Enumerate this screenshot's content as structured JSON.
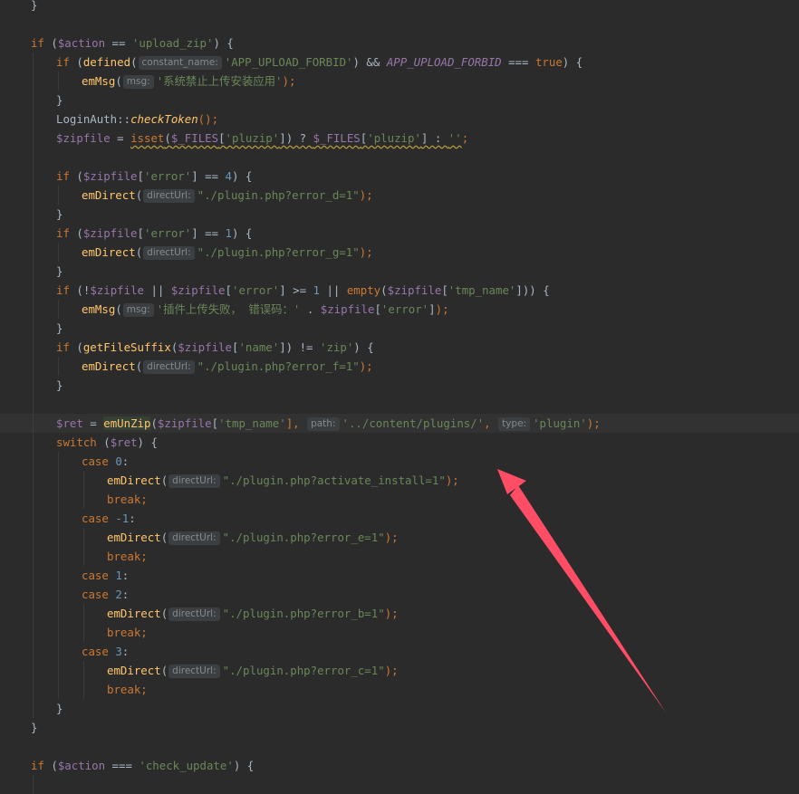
{
  "colors": {
    "background": "#2b2b2b",
    "current_line": "#323232",
    "keyword": "#cc7832",
    "variable": "#9876aa",
    "string": "#6a8759",
    "number": "#6897bb",
    "function": "#ffc66d",
    "plain": "#a9b7c6",
    "hint_background": "#3b3f41",
    "hint_text": "#868a8c",
    "annotation_arrow": "#ff4d66"
  },
  "annotation": {
    "icon": "red-arrow-icon"
  },
  "code_lines": [
    {
      "indent": 0,
      "tokens": [
        {
          "t": "}",
          "c": "pln"
        }
      ]
    },
    {
      "indent": 0,
      "tokens": []
    },
    {
      "indent": 0,
      "tokens": [
        {
          "t": "if",
          "c": "kw"
        },
        {
          "t": " (",
          "c": "pln"
        },
        {
          "t": "$action",
          "c": "var"
        },
        {
          "t": " == ",
          "c": "pln"
        },
        {
          "t": "'upload_zip'",
          "c": "str"
        },
        {
          "t": ") {",
          "c": "pln"
        }
      ]
    },
    {
      "indent": 1,
      "tokens": [
        {
          "t": "if",
          "c": "kw"
        },
        {
          "t": " (",
          "c": "pln"
        },
        {
          "t": "defined",
          "c": "fn"
        },
        {
          "t": "(",
          "c": "pln"
        },
        {
          "t": "constant_name:",
          "c": "hint"
        },
        {
          "t": "'APP_UPLOAD_FORBID'",
          "c": "str"
        },
        {
          "t": ") && ",
          "c": "pln"
        },
        {
          "t": "APP_UPLOAD_FORBID",
          "c": "cst"
        },
        {
          "t": " === ",
          "c": "pln"
        },
        {
          "t": "true",
          "c": "kw"
        },
        {
          "t": ") {",
          "c": "pln"
        }
      ]
    },
    {
      "indent": 2,
      "tokens": [
        {
          "t": "emMsg",
          "c": "fn"
        },
        {
          "t": "(",
          "c": "pln"
        },
        {
          "t": "msg:",
          "c": "hint"
        },
        {
          "t": "'系统禁止上传安装应用'",
          "c": "str"
        },
        {
          "t": ");",
          "c": "kw"
        }
      ]
    },
    {
      "indent": 1,
      "tokens": [
        {
          "t": "}",
          "c": "pln"
        }
      ]
    },
    {
      "indent": 1,
      "tokens": [
        {
          "t": "LoginAuth::",
          "c": "pln"
        },
        {
          "t": "checkToken",
          "c": "sfn"
        },
        {
          "t": "();",
          "c": "kw"
        }
      ]
    },
    {
      "indent": 1,
      "tokens": [
        {
          "t": "$zipfile",
          "c": "var"
        },
        {
          "t": " = ",
          "c": "pln"
        },
        {
          "t": "isset",
          "c": "kw",
          "w": true
        },
        {
          "t": "(",
          "c": "pln",
          "w": true
        },
        {
          "t": "$_FILES",
          "c": "var",
          "w": true
        },
        {
          "t": "[",
          "c": "pln",
          "w": true
        },
        {
          "t": "'pluzip'",
          "c": "str",
          "w": true
        },
        {
          "t": "]) ? ",
          "c": "pln",
          "w": true
        },
        {
          "t": "$_FILES",
          "c": "var",
          "w": true
        },
        {
          "t": "[",
          "c": "pln",
          "w": true
        },
        {
          "t": "'pluzip'",
          "c": "str",
          "w": true
        },
        {
          "t": "] : ",
          "c": "pln",
          "w": true
        },
        {
          "t": "''",
          "c": "str",
          "w": true
        },
        {
          "t": ";",
          "c": "kw"
        }
      ]
    },
    {
      "indent": 1,
      "tokens": []
    },
    {
      "indent": 1,
      "tokens": [
        {
          "t": "if",
          "c": "kw"
        },
        {
          "t": " (",
          "c": "pln"
        },
        {
          "t": "$zipfile",
          "c": "var"
        },
        {
          "t": "[",
          "c": "pln"
        },
        {
          "t": "'error'",
          "c": "str"
        },
        {
          "t": "] == ",
          "c": "pln"
        },
        {
          "t": "4",
          "c": "num"
        },
        {
          "t": ") {",
          "c": "pln"
        }
      ]
    },
    {
      "indent": 2,
      "tokens": [
        {
          "t": "emDirect",
          "c": "fn"
        },
        {
          "t": "(",
          "c": "pln"
        },
        {
          "t": "directUrl:",
          "c": "hint"
        },
        {
          "t": "\"./plugin.php?error_d=1\"",
          "c": "str"
        },
        {
          "t": ");",
          "c": "kw"
        }
      ]
    },
    {
      "indent": 1,
      "tokens": [
        {
          "t": "}",
          "c": "pln"
        }
      ]
    },
    {
      "indent": 1,
      "tokens": [
        {
          "t": "if",
          "c": "kw"
        },
        {
          "t": " (",
          "c": "pln"
        },
        {
          "t": "$zipfile",
          "c": "var"
        },
        {
          "t": "[",
          "c": "pln"
        },
        {
          "t": "'error'",
          "c": "str"
        },
        {
          "t": "] == ",
          "c": "pln"
        },
        {
          "t": "1",
          "c": "num"
        },
        {
          "t": ") {",
          "c": "pln"
        }
      ]
    },
    {
      "indent": 2,
      "tokens": [
        {
          "t": "emDirect",
          "c": "fn"
        },
        {
          "t": "(",
          "c": "pln"
        },
        {
          "t": "directUrl:",
          "c": "hint"
        },
        {
          "t": "\"./plugin.php?error_g=1\"",
          "c": "str"
        },
        {
          "t": ");",
          "c": "kw"
        }
      ]
    },
    {
      "indent": 1,
      "tokens": [
        {
          "t": "}",
          "c": "pln"
        }
      ]
    },
    {
      "indent": 1,
      "tokens": [
        {
          "t": "if",
          "c": "kw"
        },
        {
          "t": " (!",
          "c": "pln"
        },
        {
          "t": "$zipfile",
          "c": "var"
        },
        {
          "t": " || ",
          "c": "pln"
        },
        {
          "t": "$zipfile",
          "c": "var"
        },
        {
          "t": "[",
          "c": "pln"
        },
        {
          "t": "'error'",
          "c": "str"
        },
        {
          "t": "] >= ",
          "c": "pln"
        },
        {
          "t": "1",
          "c": "num"
        },
        {
          "t": " || ",
          "c": "pln"
        },
        {
          "t": "empty",
          "c": "kw"
        },
        {
          "t": "(",
          "c": "pln"
        },
        {
          "t": "$zipfile",
          "c": "var"
        },
        {
          "t": "[",
          "c": "pln"
        },
        {
          "t": "'tmp_name'",
          "c": "str"
        },
        {
          "t": "])) {",
          "c": "pln"
        }
      ]
    },
    {
      "indent": 2,
      "tokens": [
        {
          "t": "emMsg",
          "c": "fn"
        },
        {
          "t": "(",
          "c": "pln"
        },
        {
          "t": "msg:",
          "c": "hint"
        },
        {
          "t": "'插件上传失败， 错误码：'",
          "c": "str"
        },
        {
          "t": " . ",
          "c": "pln"
        },
        {
          "t": "$zipfile",
          "c": "var"
        },
        {
          "t": "[",
          "c": "pln"
        },
        {
          "t": "'error'",
          "c": "str"
        },
        {
          "t": "]",
          "c": "pln"
        },
        {
          "t": ");",
          "c": "kw"
        }
      ]
    },
    {
      "indent": 1,
      "tokens": [
        {
          "t": "}",
          "c": "pln"
        }
      ]
    },
    {
      "indent": 1,
      "tokens": [
        {
          "t": "if",
          "c": "kw"
        },
        {
          "t": " (",
          "c": "pln"
        },
        {
          "t": "getFileSuffix",
          "c": "fn"
        },
        {
          "t": "(",
          "c": "pln"
        },
        {
          "t": "$zipfile",
          "c": "var"
        },
        {
          "t": "[",
          "c": "pln"
        },
        {
          "t": "'name'",
          "c": "str"
        },
        {
          "t": "]) != ",
          "c": "pln"
        },
        {
          "t": "'zip'",
          "c": "str"
        },
        {
          "t": ") {",
          "c": "pln"
        }
      ]
    },
    {
      "indent": 2,
      "tokens": [
        {
          "t": "emDirect",
          "c": "fn"
        },
        {
          "t": "(",
          "c": "pln"
        },
        {
          "t": "directUrl:",
          "c": "hint"
        },
        {
          "t": "\"./plugin.php?error_f=1\"",
          "c": "str"
        },
        {
          "t": ");",
          "c": "kw"
        }
      ]
    },
    {
      "indent": 1,
      "tokens": [
        {
          "t": "}",
          "c": "pln"
        }
      ]
    },
    {
      "indent": 1,
      "tokens": []
    },
    {
      "indent": 1,
      "current": true,
      "tokens": [
        {
          "t": "$ret",
          "c": "var"
        },
        {
          "t": " = ",
          "c": "pln"
        },
        {
          "t": "emUnZip",
          "c": "hl"
        },
        {
          "t": "(",
          "c": "pln"
        },
        {
          "t": "$zipfile",
          "c": "var"
        },
        {
          "t": "[",
          "c": "pln"
        },
        {
          "t": "'tmp_name'",
          "c": "str"
        },
        {
          "t": "], ",
          "c": "kw"
        },
        {
          "t": "path:",
          "c": "hint"
        },
        {
          "t": "'../content/plugins/'",
          "c": "str"
        },
        {
          "t": ", ",
          "c": "kw"
        },
        {
          "t": "type:",
          "c": "hint"
        },
        {
          "t": "'plugin'",
          "c": "str"
        },
        {
          "t": ");",
          "c": "kw"
        }
      ]
    },
    {
      "indent": 1,
      "tokens": [
        {
          "t": "switch",
          "c": "kw"
        },
        {
          "t": " (",
          "c": "pln"
        },
        {
          "t": "$ret",
          "c": "var"
        },
        {
          "t": ") {",
          "c": "pln"
        }
      ]
    },
    {
      "indent": 2,
      "tokens": [
        {
          "t": "case",
          "c": "kw"
        },
        {
          "t": " ",
          "c": "pln"
        },
        {
          "t": "0",
          "c": "num"
        },
        {
          "t": ":",
          "c": "pln"
        }
      ]
    },
    {
      "indent": 3,
      "tokens": [
        {
          "t": "emDirect",
          "c": "fn"
        },
        {
          "t": "(",
          "c": "pln"
        },
        {
          "t": "directUrl:",
          "c": "hint"
        },
        {
          "t": "\"./plugin.php?activate_install=1\"",
          "c": "str"
        },
        {
          "t": ");",
          "c": "kw"
        }
      ]
    },
    {
      "indent": 3,
      "tokens": [
        {
          "t": "break;",
          "c": "kw"
        }
      ]
    },
    {
      "indent": 2,
      "tokens": [
        {
          "t": "case",
          "c": "kw"
        },
        {
          "t": " ",
          "c": "pln"
        },
        {
          "t": "-1",
          "c": "num"
        },
        {
          "t": ":",
          "c": "pln"
        }
      ]
    },
    {
      "indent": 3,
      "tokens": [
        {
          "t": "emDirect",
          "c": "fn"
        },
        {
          "t": "(",
          "c": "pln"
        },
        {
          "t": "directUrl:",
          "c": "hint"
        },
        {
          "t": "\"./plugin.php?error_e=1\"",
          "c": "str"
        },
        {
          "t": ");",
          "c": "kw"
        }
      ]
    },
    {
      "indent": 3,
      "tokens": [
        {
          "t": "break;",
          "c": "kw"
        }
      ]
    },
    {
      "indent": 2,
      "tokens": [
        {
          "t": "case",
          "c": "kw"
        },
        {
          "t": " ",
          "c": "pln"
        },
        {
          "t": "1",
          "c": "num"
        },
        {
          "t": ":",
          "c": "pln"
        }
      ]
    },
    {
      "indent": 2,
      "tokens": [
        {
          "t": "case",
          "c": "kw"
        },
        {
          "t": " ",
          "c": "pln"
        },
        {
          "t": "2",
          "c": "num"
        },
        {
          "t": ":",
          "c": "pln"
        }
      ]
    },
    {
      "indent": 3,
      "tokens": [
        {
          "t": "emDirect",
          "c": "fn"
        },
        {
          "t": "(",
          "c": "pln"
        },
        {
          "t": "directUrl:",
          "c": "hint"
        },
        {
          "t": "\"./plugin.php?error_b=1\"",
          "c": "str"
        },
        {
          "t": ");",
          "c": "kw"
        }
      ]
    },
    {
      "indent": 3,
      "tokens": [
        {
          "t": "break;",
          "c": "kw"
        }
      ]
    },
    {
      "indent": 2,
      "tokens": [
        {
          "t": "case",
          "c": "kw"
        },
        {
          "t": " ",
          "c": "pln"
        },
        {
          "t": "3",
          "c": "num"
        },
        {
          "t": ":",
          "c": "pln"
        }
      ]
    },
    {
      "indent": 3,
      "tokens": [
        {
          "t": "emDirect",
          "c": "fn"
        },
        {
          "t": "(",
          "c": "pln"
        },
        {
          "t": "directUrl:",
          "c": "hint"
        },
        {
          "t": "\"./plugin.php?error_c=1\"",
          "c": "str"
        },
        {
          "t": ");",
          "c": "kw"
        }
      ]
    },
    {
      "indent": 3,
      "tokens": [
        {
          "t": "break;",
          "c": "kw"
        }
      ]
    },
    {
      "indent": 1,
      "tokens": [
        {
          "t": "}",
          "c": "pln"
        }
      ]
    },
    {
      "indent": 0,
      "tokens": [
        {
          "t": "}",
          "c": "pln"
        }
      ]
    },
    {
      "indent": 0,
      "tokens": []
    },
    {
      "indent": 0,
      "tokens": [
        {
          "t": "if",
          "c": "kw"
        },
        {
          "t": " (",
          "c": "pln"
        },
        {
          "t": "$action",
          "c": "var"
        },
        {
          "t": " === ",
          "c": "pln"
        },
        {
          "t": "'check_update'",
          "c": "str"
        },
        {
          "t": ") {",
          "c": "pln"
        }
      ]
    },
    {
      "indent": 1,
      "tokens": []
    }
  ]
}
